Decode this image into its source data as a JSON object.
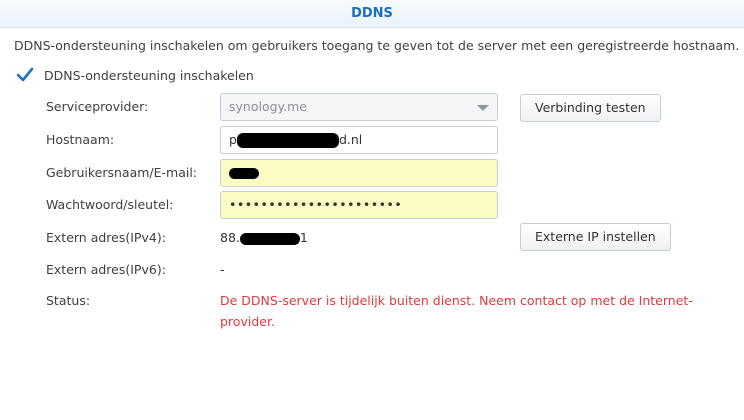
{
  "header": {
    "title": "DDNS"
  },
  "description": "DDNS-ondersteuning inschakelen om gebruikers toegang te geven tot de server met een geregistreerde hostnaam.",
  "enable_checkbox": {
    "label": "DDNS-ondersteuning inschakelen",
    "checked": true
  },
  "form": {
    "service_provider": {
      "label": "Serviceprovider:",
      "value": "synology.me"
    },
    "test_button": "Verbinding testen",
    "hostname": {
      "label": "Hostnaam:",
      "prefix": "p",
      "suffix": "d.nl"
    },
    "username": {
      "label": "Gebruikersnaam/E-mail:"
    },
    "password": {
      "label": "Wachtwoord/sleutel:",
      "value": "••••••••••••••••••••••"
    },
    "ipv4": {
      "label": "Extern adres(IPv4):",
      "prefix": "88.",
      "suffix": "1"
    },
    "set_ip_button": "Externe IP instellen",
    "ipv6": {
      "label": "Extern adres(IPv6):",
      "value": "-"
    },
    "status": {
      "label": "Status:",
      "value": "De DDNS-server is tijdelijk buiten dienst. Neem contact op met de Internet-provider."
    }
  },
  "colors": {
    "accent": "#1c6fbf",
    "error": "#e0393e",
    "autofill": "#fbfbc4"
  }
}
